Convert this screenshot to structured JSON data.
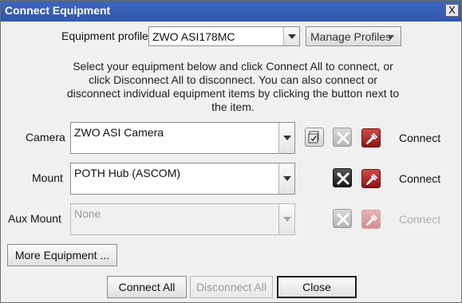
{
  "window": {
    "title": "Connect Equipment",
    "close_label": "X"
  },
  "profile": {
    "label": "Equipment profile",
    "value": "ZWO ASI178MC",
    "manage_label": "Manage Profiles"
  },
  "instructions": "Select your equipment below and click Connect All to connect, or click Disconnect All to disconnect. You can also connect or disconnect individual equipment items by clicking the button next to the item.",
  "devices": [
    {
      "label": "Camera",
      "value": "ZWO ASI Camera",
      "status": "Connect",
      "enabled": true
    },
    {
      "label": "Mount",
      "value": "POTH Hub (ASCOM)",
      "status": "Connect",
      "enabled": true
    },
    {
      "label": "Aux Mount",
      "value": "None",
      "status": "Connect",
      "enabled": false
    }
  ],
  "buttons": {
    "more_equipment": "More Equipment ...",
    "connect_all": "Connect All",
    "disconnect_all": "Disconnect All",
    "close": "Close"
  },
  "icons": {
    "camera_setup": "camera-settings-icon",
    "tools": "tools-icon",
    "plug": "plug-icon"
  },
  "colors": {
    "title_bar": "#2f58ae",
    "plug_active": "#b72222",
    "plug_disabled": "#e2a7a7"
  }
}
